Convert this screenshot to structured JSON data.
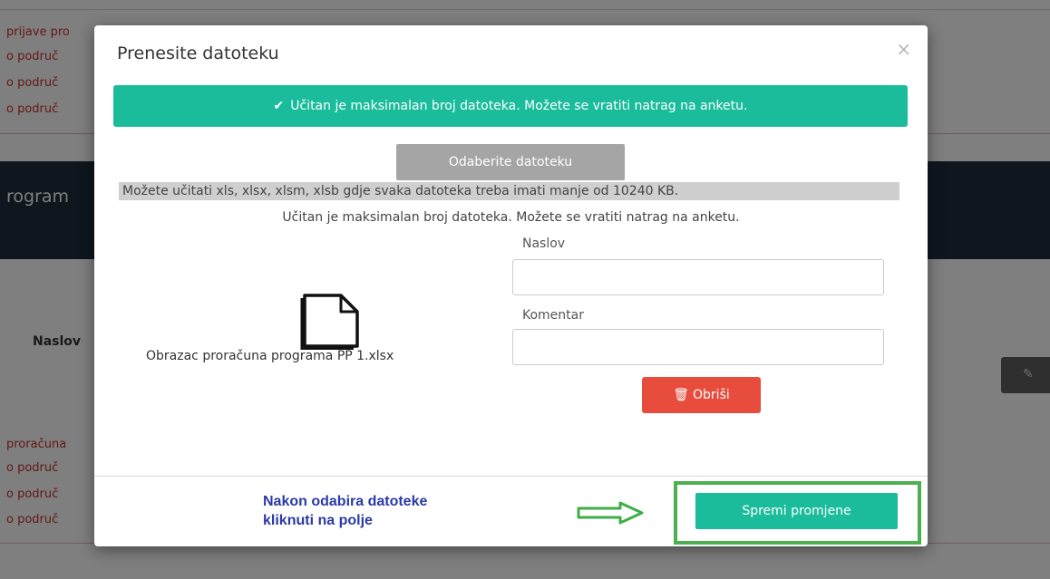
{
  "background": {
    "red_lines_top": [
      "prijave pro",
      "o područ",
      "o područ",
      "o područ"
    ],
    "band_title": "rogram",
    "naslov_label": "Naslov",
    "red_lines_bottom": [
      "proračuna",
      "o područ",
      "o područ",
      "o područ"
    ],
    "edit_icon": "pencil-icon"
  },
  "modal": {
    "title": "Prenesite datoteku",
    "close_icon": "×",
    "alert": {
      "icon": "✔",
      "text": "Učitan je maksimalan broj datoteka. Možete se vratiti natrag na anketu."
    },
    "choose_button": "Odaberite datoteku",
    "hint": "Možete učitati xls, xlsx, xlsm, xlsb gdje svaka datoteka treba imati manje od 10240 KB.",
    "max_info": "Učitan je maksimalan broj datoteka. Možete se vratiti natrag na anketu.",
    "file_name": "Obrazac proračuna programa PP 1.xlsx",
    "fields": {
      "naslov_label": "Naslov",
      "naslov_value": "",
      "komentar_label": "Komentar",
      "komentar_value": ""
    },
    "delete_button": "Obriši",
    "footer_note_line1": "Nakon odabira datoteke",
    "footer_note_line2": "kliknuti na polje",
    "save_button": "Spremi promjene"
  },
  "colors": {
    "accent_teal": "#1abc9c",
    "danger_red": "#e74c3c",
    "highlight_green": "#4caf50",
    "note_blue": "#2a3aa6"
  }
}
